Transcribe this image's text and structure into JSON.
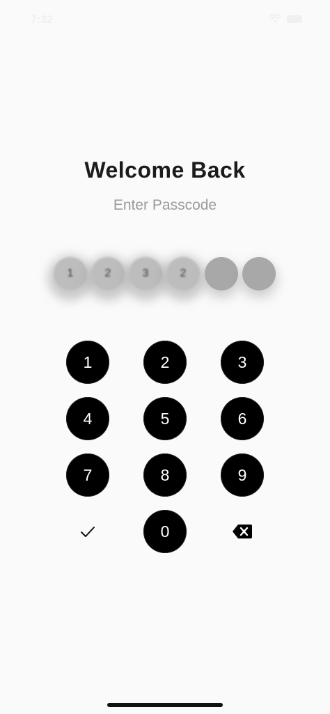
{
  "status_bar": {
    "time": "7:32",
    "icons": [
      "wifi-icon",
      "battery-icon"
    ]
  },
  "header": {
    "title": "Welcome Back",
    "subtitle": "Enter Passcode"
  },
  "passcode": {
    "entered_digits": [
      "1",
      "2",
      "3",
      "2"
    ],
    "total_length": 6,
    "filled_count": 4
  },
  "keypad": {
    "keys": [
      "1",
      "2",
      "3",
      "4",
      "5",
      "6",
      "7",
      "8",
      "9",
      "0"
    ],
    "confirm_icon": "checkmark-icon",
    "delete_icon": "backspace-icon"
  },
  "colors": {
    "background": "#fafafa",
    "key_fill": "#000000",
    "key_text": "#ffffff",
    "title": "#1b1b1b",
    "subtitle": "#9a9a9a",
    "empty_slot": "#a8a8a8"
  }
}
